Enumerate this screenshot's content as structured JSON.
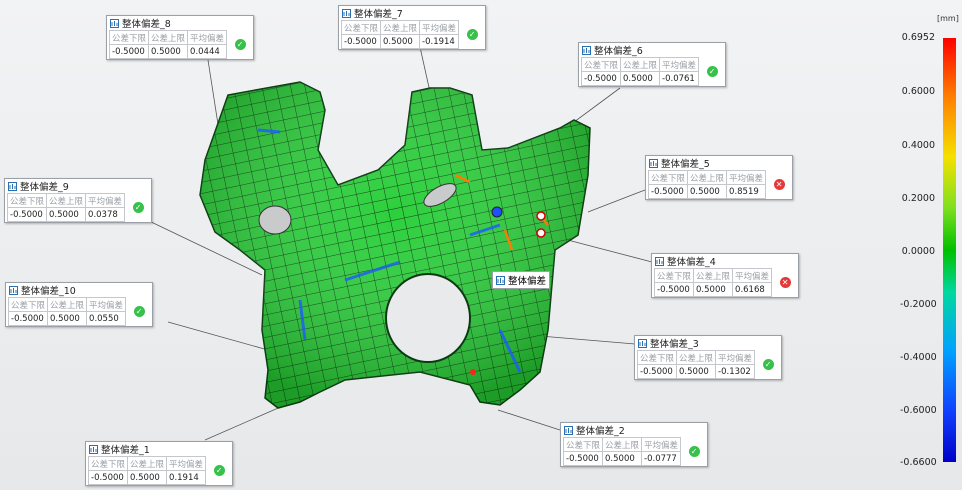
{
  "units": "[mm]",
  "legend_ticks": [
    "0.6952",
    "0.6000",
    "0.4000",
    "0.2000",
    "0.0000",
    "-0.2000",
    "-0.4000",
    "-0.6000",
    "-0.6600"
  ],
  "center_label": "整体偏差",
  "colors": {
    "ok": "#37c14a",
    "fail": "#e23a3a",
    "part_green": "#22c03a"
  },
  "callouts": [
    {
      "title": "整体偏差_8",
      "lower_label": "公差下限",
      "upper_label": "公差上限",
      "avg_label": "平均偏差",
      "lower": "-0.5000",
      "upper": "0.5000",
      "avg": "0.0444",
      "status": "ok"
    },
    {
      "title": "整体偏差_7",
      "lower_label": "公差下限",
      "upper_label": "公差上限",
      "avg_label": "平均偏差",
      "lower": "-0.5000",
      "upper": "0.5000",
      "avg": "-0.1914",
      "status": "ok"
    },
    {
      "title": "整体偏差_6",
      "lower_label": "公差下限",
      "upper_label": "公差上限",
      "avg_label": "平均偏差",
      "lower": "-0.5000",
      "upper": "0.5000",
      "avg": "-0.0761",
      "status": "ok"
    },
    {
      "title": "整体偏差_5",
      "lower_label": "公差下限",
      "upper_label": "公差上限",
      "avg_label": "平均偏差",
      "lower": "-0.5000",
      "upper": "0.5000",
      "avg": "0.8519",
      "status": "fail"
    },
    {
      "title": "整体偏差_9",
      "lower_label": "公差下限",
      "upper_label": "公差上限",
      "avg_label": "平均偏差",
      "lower": "-0.5000",
      "upper": "0.5000",
      "avg": "0.0378",
      "status": "ok"
    },
    {
      "title": "整体偏差_4",
      "lower_label": "公差下限",
      "upper_label": "公差上限",
      "avg_label": "平均偏差",
      "lower": "-0.5000",
      "upper": "0.5000",
      "avg": "0.6168",
      "status": "fail"
    },
    {
      "title": "整体偏差_10",
      "lower_label": "公差下限",
      "upper_label": "公差上限",
      "avg_label": "平均偏差",
      "lower": "-0.5000",
      "upper": "0.5000",
      "avg": "0.0550",
      "status": "ok"
    },
    {
      "title": "整体偏差_3",
      "lower_label": "公差下限",
      "upper_label": "公差上限",
      "avg_label": "平均偏差",
      "lower": "-0.5000",
      "upper": "0.5000",
      "avg": "-0.1302",
      "status": "ok"
    },
    {
      "title": "整体偏差_1",
      "lower_label": "公差下限",
      "upper_label": "公差上限",
      "avg_label": "平均偏差",
      "lower": "-0.5000",
      "upper": "0.5000",
      "avg": "0.1914",
      "status": "ok"
    },
    {
      "title": "整体偏差_2",
      "lower_label": "公差下限",
      "upper_label": "公差上限",
      "avg_label": "平均偏差",
      "lower": "-0.5000",
      "upper": "0.5000",
      "avg": "-0.0777",
      "status": "ok"
    }
  ]
}
